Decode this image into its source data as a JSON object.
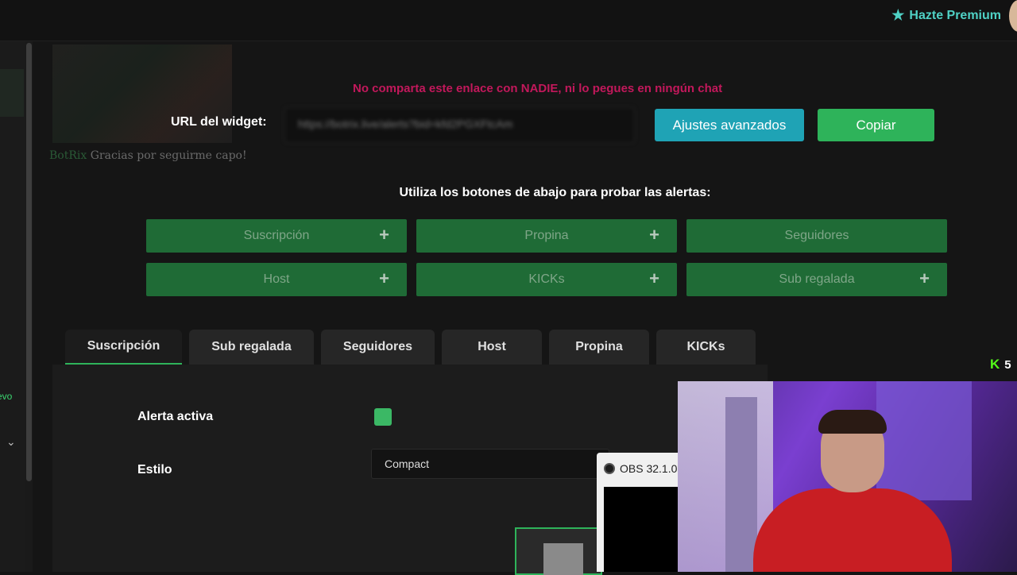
{
  "header": {
    "premium_label": "Hazte Premium",
    "premium_icon": "star-icon",
    "accent": "#4fd1c5"
  },
  "sidebar": {
    "new_badge": "evo"
  },
  "preview": {
    "brand": "BotRix",
    "message": "Gracias por seguirme capo!"
  },
  "widget": {
    "warning": "No comparta este enlace con NADIE, ni lo pegues en ningún chat",
    "url_label": "URL del widget:",
    "url_value": "https://botrix.live/alerts?bid=kfd2PGXFtcAm",
    "advanced_button": "Ajustes avanzados",
    "copy_button": "Copiar"
  },
  "test_alerts": {
    "hint": "Utiliza los botones de abajo para probar las alertas:",
    "buttons": [
      {
        "label": "Suscripción",
        "plus": "+"
      },
      {
        "label": "Propina",
        "plus": "+"
      },
      {
        "label": "Seguidores",
        "plus": ""
      },
      {
        "label": "Host",
        "plus": "+"
      },
      {
        "label": "KICKs",
        "plus": "+"
      },
      {
        "label": "Sub regalada",
        "plus": "+"
      }
    ]
  },
  "tabs": [
    {
      "label": "Suscripción",
      "active": true
    },
    {
      "label": "Sub regalada",
      "active": false
    },
    {
      "label": "Seguidores",
      "active": false
    },
    {
      "label": "Host",
      "active": false
    },
    {
      "label": "Propina",
      "active": false
    },
    {
      "label": "KICKs",
      "active": false
    }
  ],
  "settings": {
    "alert_active_label": "Alerta activa",
    "alert_active_value": true,
    "style_label": "Estilo",
    "style_value": "Compact"
  },
  "obs": {
    "title": "OBS 32.1.0"
  },
  "kick_badge": {
    "icon": "K",
    "count": "5",
    "color": "#53fc18"
  },
  "colors": {
    "primary_green": "#2eb35a",
    "teal_button": "#1fa3b5",
    "warning": "#c2185b",
    "test_button_bg": "#1f6b36"
  }
}
